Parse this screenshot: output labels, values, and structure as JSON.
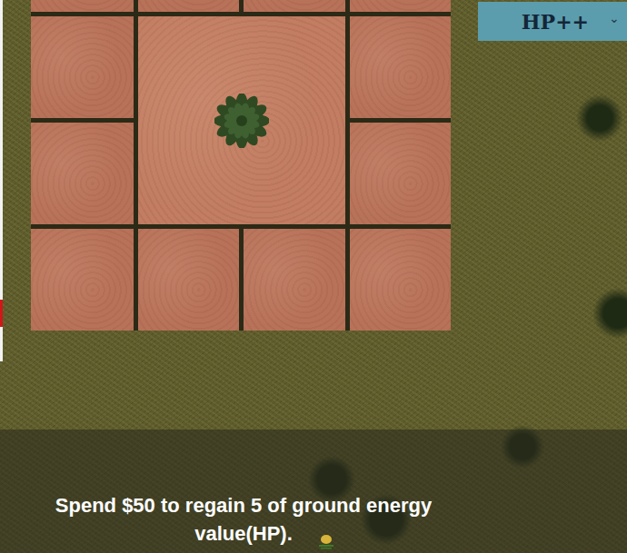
{
  "dropdown": {
    "value": "HP++",
    "chevron": "⌄"
  },
  "field": {
    "tiles": [
      {
        "kind": "plot"
      },
      {
        "kind": "plot"
      },
      {
        "kind": "plot"
      },
      {
        "kind": "plot"
      },
      {
        "kind": "plot"
      },
      {
        "kind": "planted"
      },
      {
        "kind": "plot"
      },
      {
        "kind": "plot"
      },
      {
        "kind": "plot"
      },
      {
        "kind": "plot"
      },
      {
        "kind": "plot"
      },
      {
        "kind": "plot"
      },
      {
        "kind": "plot"
      }
    ]
  },
  "message": {
    "text": "Spend $50 to regain 5 of ground energy value(HP)."
  }
}
